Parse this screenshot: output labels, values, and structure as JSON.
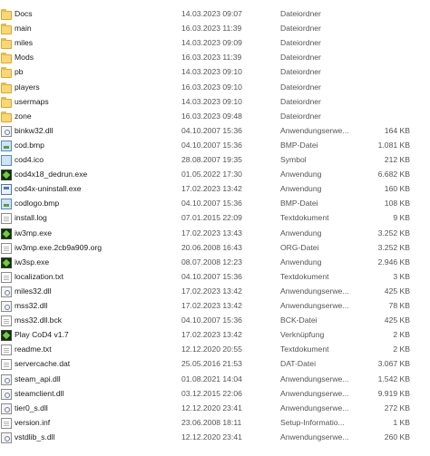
{
  "files": [
    {
      "name": "Docs",
      "date": "14.03.2023 09:07",
      "type": "Dateiordner",
      "size": "",
      "icon": "folder-icon",
      "icon_class": "folder"
    },
    {
      "name": "main",
      "date": "16.03.2023 11:39",
      "type": "Dateiordner",
      "size": "",
      "icon": "folder-icon",
      "icon_class": "folder"
    },
    {
      "name": "miles",
      "date": "14.03.2023 09:09",
      "type": "Dateiordner",
      "size": "",
      "icon": "folder-icon",
      "icon_class": "folder"
    },
    {
      "name": "Mods",
      "date": "16.03.2023 11:39",
      "type": "Dateiordner",
      "size": "",
      "icon": "folder-icon",
      "icon_class": "folder"
    },
    {
      "name": "pb",
      "date": "14.03.2023 09:10",
      "type": "Dateiordner",
      "size": "",
      "icon": "folder-icon",
      "icon_class": "folder"
    },
    {
      "name": "players",
      "date": "16.03.2023 09:10",
      "type": "Dateiordner",
      "size": "",
      "icon": "folder-icon",
      "icon_class": "folder"
    },
    {
      "name": "usermaps",
      "date": "14.03.2023 09:10",
      "type": "Dateiordner",
      "size": "",
      "icon": "folder-icon",
      "icon_class": "folder"
    },
    {
      "name": "zone",
      "date": "16.03.2023 09:48",
      "type": "Dateiordner",
      "size": "",
      "icon": "folder-icon",
      "icon_class": "folder"
    },
    {
      "name": "binkw32.dll",
      "date": "04.10.2007 15:36",
      "type": "Anwendungserwe...",
      "size": "164 KB",
      "icon": "dll-file-icon",
      "icon_class": "dll"
    },
    {
      "name": "cod.bmp",
      "date": "04.10.2007 15:36",
      "type": "BMP-Datei",
      "size": "1.081 KB",
      "icon": "bitmap-file-icon",
      "icon_class": "bmp"
    },
    {
      "name": "cod4.ico",
      "date": "28.08.2007 19:35",
      "type": "Symbol",
      "size": "212 KB",
      "icon": "icon-file-icon",
      "icon_class": "ico"
    },
    {
      "name": "cod4x18_dedrun.exe",
      "date": "01.05.2022 17:30",
      "type": "Anwendung",
      "size": "6.682 KB",
      "icon": "cod4-exe-icon",
      "icon_class": "exe-cod"
    },
    {
      "name": "cod4x-uninstall.exe",
      "date": "17.02.2023 13:42",
      "type": "Anwendung",
      "size": "160 KB",
      "icon": "uninstall-exe-icon",
      "icon_class": "exe-blue"
    },
    {
      "name": "codlogo.bmp",
      "date": "04.10.2007 15:36",
      "type": "BMP-Datei",
      "size": "108 KB",
      "icon": "bitmap-file-icon",
      "icon_class": "bmp"
    },
    {
      "name": "install.log",
      "date": "07.01.2015 22:09",
      "type": "Textdokument",
      "size": "9 KB",
      "icon": "text-file-icon",
      "icon_class": "doc"
    },
    {
      "name": "iw3mp.exe",
      "date": "17.02.2023 13:43",
      "type": "Anwendung",
      "size": "3.252 KB",
      "icon": "cod4-exe-icon",
      "icon_class": "exe-cod"
    },
    {
      "name": "iw3mp.exe.2cb9a909.org",
      "date": "20.06.2008 16:43",
      "type": "ORG-Datei",
      "size": "3.252 KB",
      "icon": "generic-file-icon",
      "icon_class": "doc"
    },
    {
      "name": "iw3sp.exe",
      "date": "08.07.2008 12:23",
      "type": "Anwendung",
      "size": "2.946 KB",
      "icon": "cod4-exe-icon",
      "icon_class": "exe-cod"
    },
    {
      "name": "localization.txt",
      "date": "04.10.2007 15:36",
      "type": "Textdokument",
      "size": "3 KB",
      "icon": "text-file-icon",
      "icon_class": "doc"
    },
    {
      "name": "miles32.dll",
      "date": "17.02.2023 13:42",
      "type": "Anwendungserwe...",
      "size": "425 KB",
      "icon": "dll-file-icon",
      "icon_class": "dll"
    },
    {
      "name": "mss32.dll",
      "date": "17.02.2023 13:42",
      "type": "Anwendungserwe...",
      "size": "78 KB",
      "icon": "dll-file-icon",
      "icon_class": "dll"
    },
    {
      "name": "mss32.dll.bck",
      "date": "04.10.2007 15:36",
      "type": "BCK-Datei",
      "size": "425 KB",
      "icon": "generic-file-icon",
      "icon_class": "doc"
    },
    {
      "name": "Play CoD4 v1.7",
      "date": "17.02.2023 13:42",
      "type": "Verknüpfung",
      "size": "2 KB",
      "icon": "shortcut-icon",
      "icon_class": "lnk"
    },
    {
      "name": "readme.txt",
      "date": "12.12.2020 20:55",
      "type": "Textdokument",
      "size": "2 KB",
      "icon": "text-file-icon",
      "icon_class": "doc"
    },
    {
      "name": "servercache.dat",
      "date": "25.05.2016 21:53",
      "type": "DAT-Datei",
      "size": "3.067 KB",
      "icon": "generic-file-icon",
      "icon_class": "doc"
    },
    {
      "name": "steam_api.dll",
      "date": "01.08.2021 14:04",
      "type": "Anwendungserwe...",
      "size": "1.542 KB",
      "icon": "dll-file-icon",
      "icon_class": "dll"
    },
    {
      "name": "steamclient.dll",
      "date": "03.12.2015 22:06",
      "type": "Anwendungserwe...",
      "size": "9.919 KB",
      "icon": "dll-file-icon",
      "icon_class": "dll"
    },
    {
      "name": "tier0_s.dll",
      "date": "12.12.2020 23:41",
      "type": "Anwendungserwe...",
      "size": "272 KB",
      "icon": "dll-file-icon",
      "icon_class": "dll"
    },
    {
      "name": "version.inf",
      "date": "23.06.2008 18:11",
      "type": "Setup-Informatio...",
      "size": "1 KB",
      "icon": "setup-info-file-icon",
      "icon_class": "doc"
    },
    {
      "name": "vstdlib_s.dll",
      "date": "12.12.2020 23:41",
      "type": "Anwendungserwe...",
      "size": "260 KB",
      "icon": "dll-file-icon",
      "icon_class": "dll"
    }
  ]
}
